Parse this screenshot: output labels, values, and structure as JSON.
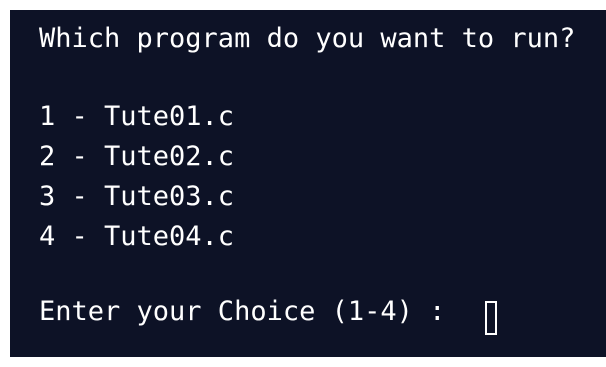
{
  "terminal": {
    "prompt": "Which program do you want to run?",
    "options": [
      "1 - Tute01.c",
      "2 - Tute02.c",
      "3 - Tute03.c",
      "4 - Tute04.c"
    ],
    "entry_prompt": "Enter your Choice (1-4) :",
    "input_value": "",
    "colors": {
      "background": "#0d1226",
      "text": "#ffffff"
    }
  }
}
